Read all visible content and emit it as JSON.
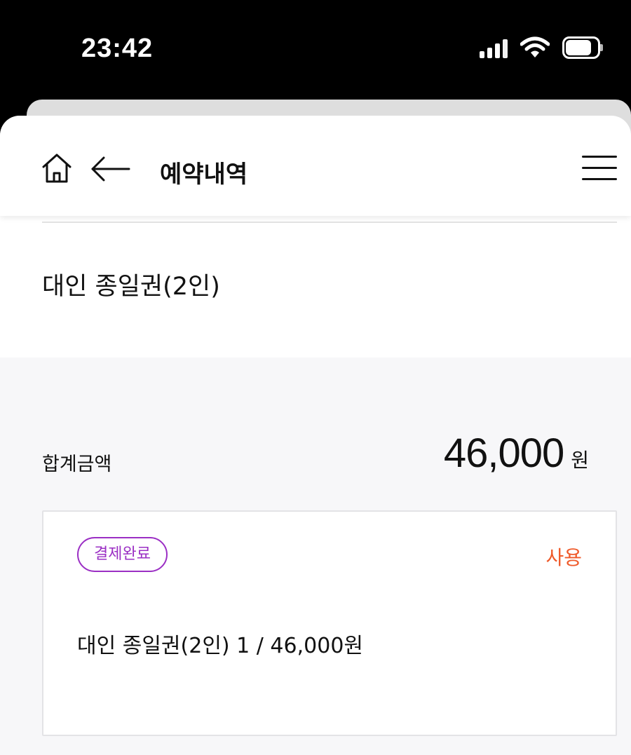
{
  "status_bar": {
    "time": "23:42",
    "icons": [
      "cellular-signal-icon",
      "wifi-icon",
      "battery-icon"
    ]
  },
  "header": {
    "title": "예약내역",
    "home_icon": "home-icon",
    "back_icon": "back-arrow-icon",
    "menu_icon": "hamburger-menu-icon"
  },
  "product": {
    "name": "대인 종일권(2인)"
  },
  "summary": {
    "total_label": "합계금액",
    "total_value": "46,000",
    "total_unit": "원"
  },
  "ticket": {
    "status": "결제완료",
    "action_label": "사용",
    "detail": "대인 종일권(2인) 1 / 46,000원"
  },
  "colors": {
    "badge_purple": "#9b2fc4",
    "action_orange": "#ef5a2a",
    "background_gray": "#f7f7f9"
  }
}
